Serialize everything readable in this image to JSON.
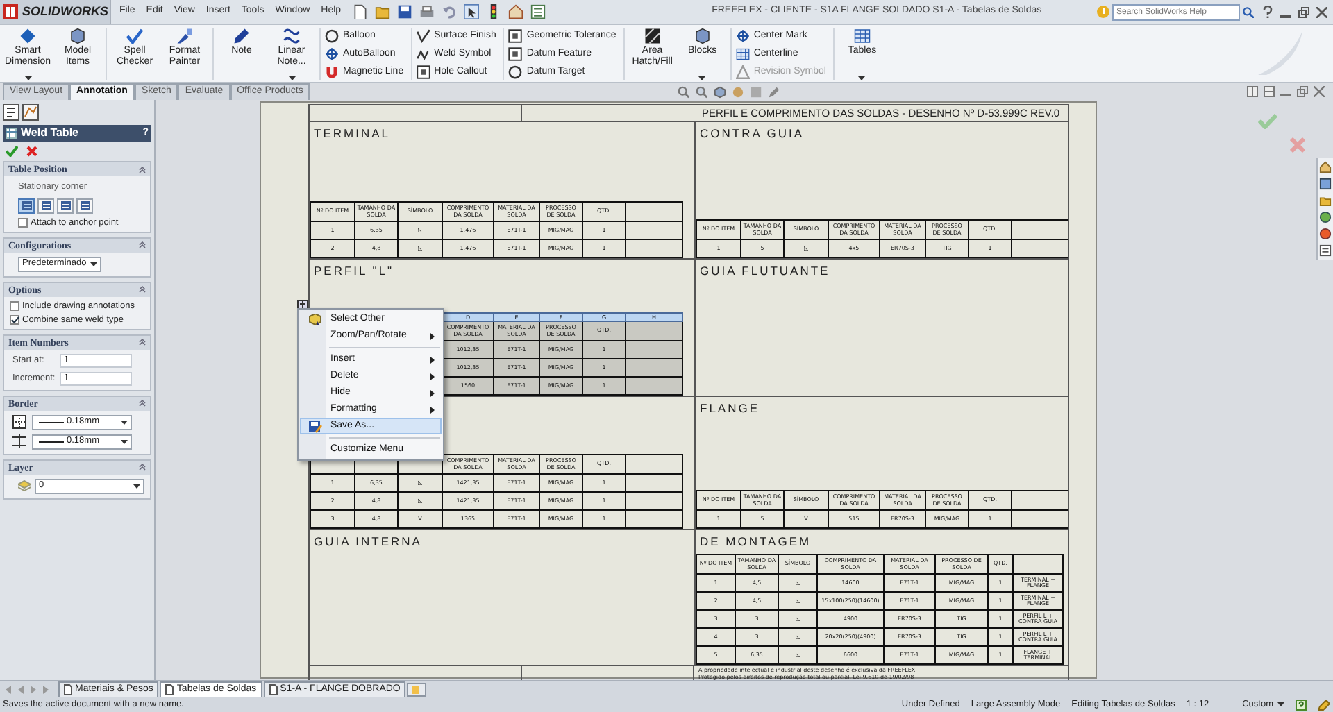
{
  "app": {
    "logo_text": "SOLIDWORKS",
    "menu": [
      "File",
      "Edit",
      "View",
      "Insert",
      "Tools",
      "Window",
      "Help"
    ],
    "title": "FREEFLEX - CLIENTE - S1A FLANGE SOLDADO S1-A - Tabelas de Soldas",
    "search_placeholder": "Search SolidWorks Help"
  },
  "ribbon": [
    {
      "kind": "large",
      "buttons": [
        {
          "label": "Smart Dimension",
          "dropdown": true
        },
        {
          "label": "Model Items",
          "dropdown": false
        }
      ]
    },
    {
      "kind": "large",
      "buttons": [
        {
          "label": "Spell Checker",
          "dropdown": false
        },
        {
          "label": "Format Painter",
          "dropdown": false
        }
      ]
    },
    {
      "kind": "large",
      "buttons": [
        {
          "label": "Note",
          "dropdown": false
        },
        {
          "label": "Linear Note...",
          "dropdown": true
        }
      ]
    },
    {
      "kind": "stack",
      "buttons": [
        {
          "label": "Balloon",
          "disabled": false
        },
        {
          "label": "AutoBalloon",
          "disabled": false
        },
        {
          "label": "Magnetic Line",
          "disabled": false
        }
      ]
    },
    {
      "kind": "stack",
      "buttons": [
        {
          "label": "Surface Finish",
          "disabled": false
        },
        {
          "label": "Weld Symbol",
          "disabled": false
        },
        {
          "label": "Hole Callout",
          "disabled": false
        }
      ]
    },
    {
      "kind": "stack",
      "buttons": [
        {
          "label": "Geometric Tolerance",
          "disabled": false
        },
        {
          "label": "Datum Feature",
          "disabled": false
        },
        {
          "label": "Datum Target",
          "disabled": false
        }
      ]
    },
    {
      "kind": "large",
      "buttons": [
        {
          "label": "Area Hatch/Fill",
          "dropdown": false
        },
        {
          "label": "Blocks",
          "dropdown": true
        }
      ]
    },
    {
      "kind": "stack",
      "buttons": [
        {
          "label": "Center Mark",
          "disabled": false
        },
        {
          "label": "Centerline",
          "disabled": false
        },
        {
          "label": "Revision Symbol",
          "disabled": true
        }
      ]
    },
    {
      "kind": "large",
      "buttons": [
        {
          "label": "Tables",
          "dropdown": true
        }
      ]
    }
  ],
  "tabs": [
    {
      "label": "View Layout",
      "selected": false
    },
    {
      "label": "Annotation",
      "selected": true
    },
    {
      "label": "Sketch",
      "selected": false
    },
    {
      "label": "Evaluate",
      "selected": false
    },
    {
      "label": "Office Products",
      "selected": false
    }
  ],
  "property_manager": {
    "title": "Weld Table",
    "help": "?",
    "groups": [
      {
        "kind": "position",
        "title": "Table Position",
        "caption": "Stationary corner",
        "corners": [
          {
            "selected": true
          },
          {
            "selected": false
          },
          {
            "selected": false
          },
          {
            "selected": false
          }
        ],
        "checkbox": {
          "label": "Attach to anchor point",
          "checked": false
        }
      },
      {
        "kind": "select",
        "title": "Configurations",
        "value": "Predeterminado"
      },
      {
        "kind": "checks",
        "title": "Options",
        "checkboxes": [
          {
            "label": "Include drawing annotations",
            "checked": false
          },
          {
            "label": "Combine same weld type",
            "checked": true
          }
        ]
      },
      {
        "kind": "fields",
        "title": "Item Numbers",
        "fields": [
          {
            "label": "Start at:",
            "value": "1"
          },
          {
            "label": "Increment:",
            "value": "1"
          }
        ]
      },
      {
        "kind": "border",
        "title": "Border",
        "selects": [
          "0.18mm",
          "0.18mm"
        ]
      },
      {
        "kind": "layer",
        "title": "Layer",
        "value": "0"
      }
    ]
  },
  "sheet": {
    "title": "PERFIL E COMPRIMENTO DAS SOLDAS - DESENHO Nº D-53.999C REV.0",
    "sections": [
      {
        "label": "TERMINAL",
        "table": {
          "selected": false,
          "headers": [
            "Nº DO ITEM",
            "TAMANHO DA SOLDA",
            "SÍMBOLO",
            "COMPRIMENTO DA SOLDA",
            "MATERIAL DA SOLDA",
            "PROCESSO DE SOLDA",
            "QTD."
          ],
          "rows": [
            [
              "1",
              "6,35",
              "◺",
              "1.476",
              "E71T-1",
              "MIG/MAG",
              "1"
            ],
            [
              "2",
              "4,8",
              "◺",
              "1.476",
              "E71T-1",
              "MIG/MAG",
              "1"
            ]
          ]
        }
      },
      {
        "label": "CONTRA GUIA",
        "table": {
          "selected": false,
          "headers": [
            "Nº DO ITEM",
            "TAMANHO DA SOLDA",
            "SÍMBOLO",
            "COMPRIMENTO DA SOLDA",
            "MATERIAL DA SOLDA",
            "PROCESSO DE SOLDA",
            "QTD."
          ],
          "rows": [
            [
              "1",
              "5",
              "◺",
              "4x5",
              "ER70S-3",
              "TIG",
              "1"
            ]
          ]
        }
      },
      {
        "label": "PERFIL \"L\"",
        "table": {
          "selected": true,
          "partly_covered": true,
          "letters": [
            "D",
            "E",
            "F",
            "G",
            "H"
          ],
          "headers": [
            "COMPRIMENTO DA SOLDA",
            "MATERIAL DA SOLDA",
            "PROCESSO DE SOLDA",
            "QTD."
          ],
          "rows": [
            [
              "1012,35",
              "E71T-1",
              "MIG/MAG",
              "1"
            ],
            [
              "1012,35",
              "E71T-1",
              "MIG/MAG",
              "1"
            ],
            [
              "1560",
              "E71T-1",
              "MIG/MAG",
              "1"
            ]
          ]
        }
      },
      {
        "label": "GUIA FLUTUANTE"
      },
      {
        "table": {
          "selected": false,
          "partly_covered": true,
          "headers": [
            "COMPRIMENTO DA SOLDA",
            "MATERIAL DA SOLDA",
            "PROCESSO DE SOLDA",
            "QTD."
          ],
          "rows": [
            [
              "1",
              "6,35",
              "◺",
              "1421,35",
              "E71T-1",
              "MIG/MAG",
              "1"
            ],
            [
              "2",
              "4,8",
              "◺",
              "1421,35",
              "E71T-1",
              "MIG/MAG",
              "1"
            ],
            [
              "3",
              "4,8",
              "V",
              "1365",
              "E71T-1",
              "MIG/MAG",
              "1"
            ]
          ]
        }
      },
      {
        "label": "FLANGE",
        "table": {
          "selected": false,
          "headers": [
            "Nº DO ITEM",
            "TAMANHO DA SOLDA",
            "SÍMBOLO",
            "COMPRIMENTO DA SOLDA",
            "MATERIAL DA SOLDA",
            "PROCESSO DE SOLDA",
            "QTD."
          ],
          "rows": [
            [
              "1",
              "5",
              "V",
              "515",
              "ER70S-3",
              "MIG/MAG",
              "1"
            ]
          ]
        }
      },
      {
        "label": "GUIA INTERNA"
      },
      {
        "label": "DE MONTAGEM",
        "table": {
          "selected": false,
          "headers": [
            "Nº DO ITEM",
            "TAMANHO DA SOLDA",
            "SÍMBOLO",
            "COMPRIMENTO DA SOLDA",
            "MATERIAL DA SOLDA",
            "PROCESSO DE SOLDA",
            "QTD."
          ],
          "rows": [
            [
              "1",
              "4,5",
              "◺",
              "14600",
              "E71T-1",
              "MIG/MAG",
              "1",
              "TERMINAL + FLANGE"
            ],
            [
              "2",
              "4,5",
              "◺",
              "15x100(250)(14600)",
              "E71T-1",
              "MIG/MAG",
              "1",
              "TERMINAL + FLANGE"
            ],
            [
              "3",
              "3",
              "◺",
              "4900",
              "ER70S-3",
              "TIG",
              "1",
              "PERFIL L + CONTRA GUIA"
            ],
            [
              "4",
              "3",
              "◺",
              "20x20(250)(4900)",
              "ER70S-3",
              "TIG",
              "1",
              "PERFIL L + CONTRA GUIA"
            ],
            [
              "5",
              "6,35",
              "◺",
              "6600",
              "E71T-1",
              "MIG/MAG",
              "1",
              "FLANGE + TERMINAL"
            ]
          ]
        }
      }
    ],
    "note": [
      "A propriedade intelectual e industrial deste desenho é exclusiva da FREEFLEX.",
      "Protegido pelos direitos de reprodução total ou parcial. Lei 9.610 de 19/02/98"
    ]
  },
  "context_menu": [
    {
      "kind": "item",
      "label": "Select Other",
      "icon": true,
      "submenu": false,
      "selected": false
    },
    {
      "kind": "item",
      "label": "Zoom/Pan/Rotate",
      "icon": false,
      "submenu": true,
      "selected": false
    },
    {
      "kind": "separator"
    },
    {
      "kind": "item",
      "label": "Insert",
      "icon": false,
      "submenu": true,
      "selected": false
    },
    {
      "kind": "item",
      "label": "Delete",
      "icon": false,
      "submenu": true,
      "selected": false
    },
    {
      "kind": "item",
      "label": "Hide",
      "icon": false,
      "submenu": true,
      "selected": false
    },
    {
      "kind": "item",
      "label": "Formatting",
      "icon": false,
      "submenu": true,
      "selected": false
    },
    {
      "kind": "item",
      "label": "Save As...",
      "icon": true,
      "submenu": false,
      "selected": true
    },
    {
      "kind": "separator"
    },
    {
      "kind": "item",
      "label": "Customize Menu",
      "icon": false,
      "submenu": false,
      "selected": false
    }
  ],
  "sheet_tabs": [
    {
      "label": "Materiais & Pesos",
      "selected": false
    },
    {
      "label": "Tabelas de Soldas",
      "selected": true
    },
    {
      "label": "S1-A - FLANGE DOBRADO",
      "selected": false
    }
  ],
  "status_bar": {
    "message": "Saves the active document with a new name.",
    "items": [
      "Under Defined",
      "Large Assembly Mode",
      "Editing Tabelas de Soldas",
      "1 : 12"
    ],
    "units": "Custom"
  }
}
